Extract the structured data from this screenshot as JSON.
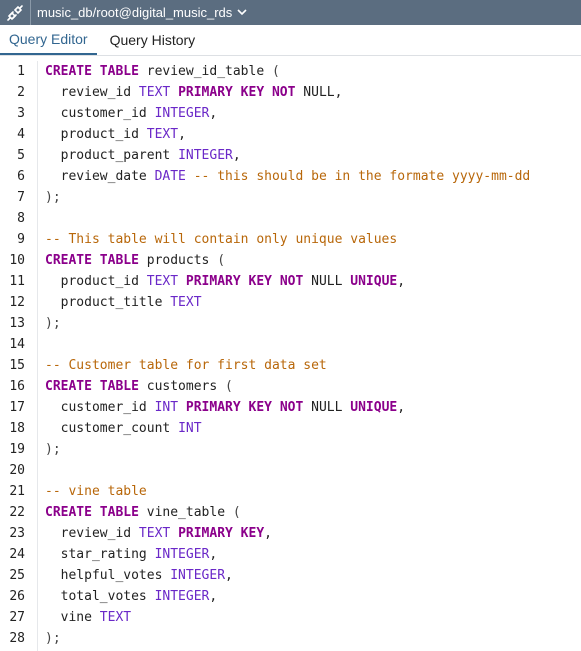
{
  "connection": {
    "label": "music_db/root@digital_music_rds"
  },
  "tabs": [
    {
      "label": "Query Editor",
      "active": true
    },
    {
      "label": "Query History",
      "active": false
    }
  ],
  "colors": {
    "keyword": "#8b008b",
    "type": "#6a28c8",
    "comment": "#b8670a",
    "topbar": "#5b6d80",
    "active_tab": "#326690"
  },
  "editor": {
    "lines": [
      {
        "n": "1",
        "tokens": [
          {
            "t": "CREATE TABLE",
            "c": "kw"
          },
          {
            "t": " review_id_table ",
            "c": ""
          },
          {
            "t": "(",
            "c": "pu"
          }
        ]
      },
      {
        "n": "2",
        "tokens": [
          {
            "t": "  review_id ",
            "c": ""
          },
          {
            "t": "TEXT",
            "c": "ty"
          },
          {
            "t": " ",
            "c": ""
          },
          {
            "t": "PRIMARY KEY",
            "c": "kw"
          },
          {
            "t": " ",
            "c": ""
          },
          {
            "t": "NOT",
            "c": "kw"
          },
          {
            "t": " NULL,",
            "c": ""
          }
        ]
      },
      {
        "n": "3",
        "tokens": [
          {
            "t": "  customer_id ",
            "c": ""
          },
          {
            "t": "INTEGER",
            "c": "ty"
          },
          {
            "t": ",",
            "c": ""
          }
        ]
      },
      {
        "n": "4",
        "tokens": [
          {
            "t": "  product_id ",
            "c": ""
          },
          {
            "t": "TEXT",
            "c": "ty"
          },
          {
            "t": ",",
            "c": ""
          }
        ]
      },
      {
        "n": "5",
        "tokens": [
          {
            "t": "  product_parent ",
            "c": ""
          },
          {
            "t": "INTEGER",
            "c": "ty"
          },
          {
            "t": ",",
            "c": ""
          }
        ]
      },
      {
        "n": "6",
        "tokens": [
          {
            "t": "  review_date ",
            "c": ""
          },
          {
            "t": "DATE",
            "c": "ty"
          },
          {
            "t": " -- this should be in the formate yyyy-mm-dd",
            "c": "cm"
          }
        ]
      },
      {
        "n": "7",
        "tokens": [
          {
            "t": ");",
            "c": "pu"
          }
        ]
      },
      {
        "n": "8",
        "tokens": []
      },
      {
        "n": "9",
        "tokens": [
          {
            "t": "-- This table will contain only unique values",
            "c": "cm"
          }
        ]
      },
      {
        "n": "10",
        "tokens": [
          {
            "t": "CREATE TABLE",
            "c": "kw"
          },
          {
            "t": " products ",
            "c": ""
          },
          {
            "t": "(",
            "c": "pu"
          }
        ]
      },
      {
        "n": "11",
        "tokens": [
          {
            "t": "  product_id ",
            "c": ""
          },
          {
            "t": "TEXT",
            "c": "ty"
          },
          {
            "t": " ",
            "c": ""
          },
          {
            "t": "PRIMARY KEY",
            "c": "kw"
          },
          {
            "t": " ",
            "c": ""
          },
          {
            "t": "NOT",
            "c": "kw"
          },
          {
            "t": " NULL ",
            "c": ""
          },
          {
            "t": "UNIQUE",
            "c": "kw"
          },
          {
            "t": ",",
            "c": ""
          }
        ]
      },
      {
        "n": "12",
        "tokens": [
          {
            "t": "  product_title ",
            "c": ""
          },
          {
            "t": "TEXT",
            "c": "ty"
          }
        ]
      },
      {
        "n": "13",
        "tokens": [
          {
            "t": ");",
            "c": "pu"
          }
        ]
      },
      {
        "n": "14",
        "tokens": []
      },
      {
        "n": "15",
        "tokens": [
          {
            "t": "-- Customer table for first data set",
            "c": "cm"
          }
        ]
      },
      {
        "n": "16",
        "tokens": [
          {
            "t": "CREATE TABLE",
            "c": "kw"
          },
          {
            "t": " customers ",
            "c": ""
          },
          {
            "t": "(",
            "c": "pu"
          }
        ]
      },
      {
        "n": "17",
        "tokens": [
          {
            "t": "  customer_id ",
            "c": ""
          },
          {
            "t": "INT",
            "c": "ty"
          },
          {
            "t": " ",
            "c": ""
          },
          {
            "t": "PRIMARY KEY",
            "c": "kw"
          },
          {
            "t": " ",
            "c": ""
          },
          {
            "t": "NOT",
            "c": "kw"
          },
          {
            "t": " NULL ",
            "c": ""
          },
          {
            "t": "UNIQUE",
            "c": "kw"
          },
          {
            "t": ",",
            "c": ""
          }
        ]
      },
      {
        "n": "18",
        "tokens": [
          {
            "t": "  customer_count ",
            "c": ""
          },
          {
            "t": "INT",
            "c": "ty"
          }
        ]
      },
      {
        "n": "19",
        "tokens": [
          {
            "t": ");",
            "c": "pu"
          }
        ]
      },
      {
        "n": "20",
        "tokens": []
      },
      {
        "n": "21",
        "tokens": [
          {
            "t": "-- vine table",
            "c": "cm"
          }
        ]
      },
      {
        "n": "22",
        "tokens": [
          {
            "t": "CREATE TABLE",
            "c": "kw"
          },
          {
            "t": " vine_table ",
            "c": ""
          },
          {
            "t": "(",
            "c": "pu"
          }
        ]
      },
      {
        "n": "23",
        "tokens": [
          {
            "t": "  review_id ",
            "c": ""
          },
          {
            "t": "TEXT",
            "c": "ty"
          },
          {
            "t": " ",
            "c": ""
          },
          {
            "t": "PRIMARY KEY",
            "c": "kw"
          },
          {
            "t": ",",
            "c": ""
          }
        ]
      },
      {
        "n": "24",
        "tokens": [
          {
            "t": "  star_rating ",
            "c": ""
          },
          {
            "t": "INTEGER",
            "c": "ty"
          },
          {
            "t": ",",
            "c": ""
          }
        ]
      },
      {
        "n": "25",
        "tokens": [
          {
            "t": "  helpful_votes ",
            "c": ""
          },
          {
            "t": "INTEGER",
            "c": "ty"
          },
          {
            "t": ",",
            "c": ""
          }
        ]
      },
      {
        "n": "26",
        "tokens": [
          {
            "t": "  total_votes ",
            "c": ""
          },
          {
            "t": "INTEGER",
            "c": "ty"
          },
          {
            "t": ",",
            "c": ""
          }
        ]
      },
      {
        "n": "27",
        "tokens": [
          {
            "t": "  vine ",
            "c": ""
          },
          {
            "t": "TEXT",
            "c": "ty"
          }
        ]
      },
      {
        "n": "28",
        "tokens": [
          {
            "t": ");",
            "c": "pu"
          }
        ]
      }
    ]
  }
}
